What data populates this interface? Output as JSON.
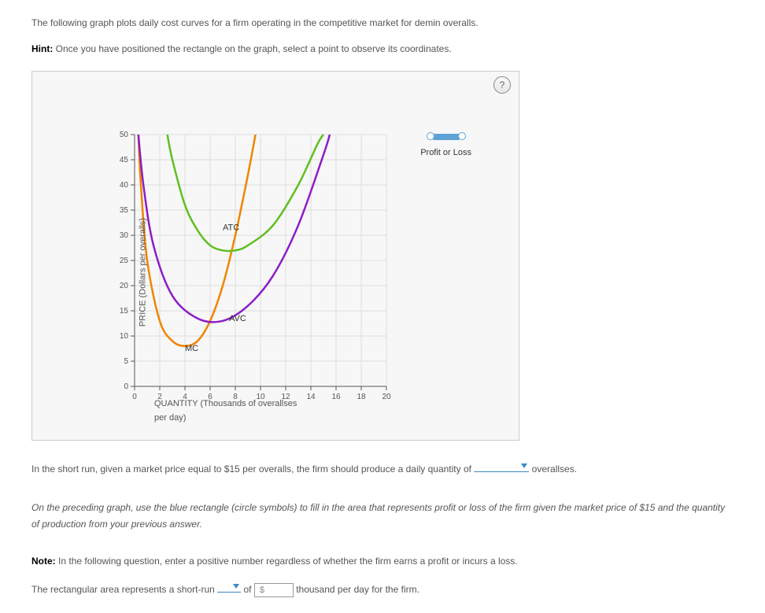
{
  "intro": "The following graph plots daily cost curves for a firm operating in the competitive market for demin overalls.",
  "hint_label": "Hint:",
  "hint_text": "Once you have positioned the rectangle on the graph, select a point to observe its coordinates.",
  "help_symbol": "?",
  "legend": {
    "label": "Profit or Loss"
  },
  "chart_data": {
    "type": "line",
    "xlabel": "QUANTITY (Thousands of overallses per day)",
    "ylabel": "PRICE (Dollars per overalls)",
    "xlim": [
      0,
      20
    ],
    "ylim": [
      0,
      50
    ],
    "xticks": [
      0,
      2,
      4,
      6,
      8,
      10,
      12,
      14,
      16,
      18,
      20
    ],
    "yticks": [
      0,
      5,
      10,
      15,
      20,
      25,
      30,
      35,
      40,
      45,
      50
    ],
    "series": [
      {
        "name": "MC",
        "color": "#f08400",
        "label_xy": [
          4,
          7
        ],
        "points": [
          [
            0.3,
            50
          ],
          [
            0.5,
            40
          ],
          [
            1,
            25
          ],
          [
            2,
            13
          ],
          [
            3,
            9
          ],
          [
            4,
            8
          ],
          [
            5,
            9
          ],
          [
            6,
            13
          ],
          [
            7,
            20
          ],
          [
            8,
            30
          ],
          [
            9,
            42
          ],
          [
            9.6,
            50
          ]
        ]
      },
      {
        "name": "AVC",
        "color": "#8e1cc7",
        "label_xy": [
          7.5,
          13
        ],
        "points": [
          [
            0.3,
            50
          ],
          [
            0.7,
            40
          ],
          [
            1.5,
            28
          ],
          [
            3,
            18
          ],
          [
            5,
            13.5
          ],
          [
            7,
            13
          ],
          [
            9,
            16
          ],
          [
            11,
            22
          ],
          [
            13,
            32
          ],
          [
            15,
            46
          ],
          [
            15.5,
            50
          ]
        ]
      },
      {
        "name": "ATC",
        "color": "#5fbf1e",
        "label_xy": [
          7,
          31
        ],
        "points": [
          [
            2.6,
            50
          ],
          [
            3,
            45
          ],
          [
            4,
            36
          ],
          [
            5,
            31
          ],
          [
            6,
            28
          ],
          [
            7,
            27
          ],
          [
            8,
            27
          ],
          [
            9,
            28
          ],
          [
            11,
            32
          ],
          [
            13,
            40
          ],
          [
            14.5,
            48
          ],
          [
            15,
            50
          ]
        ]
      }
    ]
  },
  "q1_before": "In the short run, given a market price equal to $15 per overalls, the firm should produce a daily quantity of",
  "q1_after": "overallses.",
  "instruction_italic": "On the preceding graph, use the blue rectangle (circle symbols) to fill in the area that represents profit or loss of the firm given the market price of $15 and the quantity of production from your previous answer.",
  "note_label": "Note:",
  "note_text": "In the following question, enter a positive number regardless of whether the firm earns a profit or incurs a loss.",
  "q2_before": "The rectangular area represents a short-run",
  "q2_mid": "of",
  "q2_input_prefix": "$",
  "q2_after": "thousand per day for the firm."
}
